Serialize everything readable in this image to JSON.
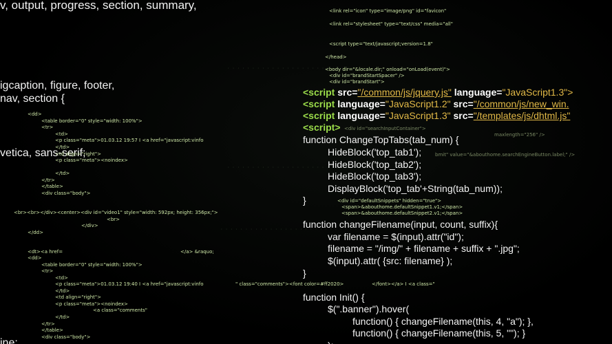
{
  "left_big": [
    "v, output, progress, section, summary,",
    "igcaption, figure, footer,",
    " nav, section {",
    "vetica, sans-serif;",
    "ine;"
  ],
  "left_small": [
    "<dd>",
    "<table border=\"0\" style=\"width: 100%\">",
    "<tr>",
    "<td>",
    "<p class=\"meta\">01.03.12 19:57 I <a href=\"javascript:vinfo",
    "</td>",
    "<td align=\"right\">",
    "<p class=\"meta\"><noindex>",
    "</td>",
    "</tr>",
    "</table>",
    "<div class=\"body\">",
    "<br><br></div><center><div id=\"video1\" style=\"width: 592px; height: 356px;\">",
    "<br>",
    "</div>",
    "</dd>",
    "<dt><a href=",
    "</a> &raquo;",
    "<dd>",
    "<table border=\"0\" style=\"width: 100%\">",
    "<tr>",
    "<td>",
    "<p class=\"meta\">01.03.12 19:40 I <a href=\"javascript:vinfo",
    "</td>",
    "<td align=\"right\">",
    "<p class=\"meta\"><noindex>",
    "<a class=\"comments\"",
    "</td>",
    "</tr>",
    "</table>",
    "<div class=\"body\">",
    "\" class=\"comments\"><font color=#ff2020>",
    "</font></a> I <a class=\""
  ],
  "right_small": [
    "<link rel=\"icon\" type=\"image/png\" id=\"favicon\"",
    "<link rel=\"stylesheet\" type=\"text/css\" media=\"all\"",
    "<script type=\"text/javascript;version=1.8\"",
    "</head>",
    "<body dir=\"&locale.dir;\" onload=\"onLoad(event)\">",
    "<div id=\"brandStartSpacer\" />",
    "<div id=\"brandStart\">",
    "<div id=\"searchInputContainer\">",
    "maxlength=\"256\" />",
    "bmit\" value=\"&abouthome.searchEngineButton.label;\" />",
    "<div id=\"defaultSnippets\" hidden=\"true\">",
    "<span>&abouthome.defaultSnippet1.v1;</span>",
    "<span>&abouthome.defaultSnippet2.v1;</span>"
  ],
  "code": {
    "script1": {
      "tag": "<script",
      "src_attr": "src=",
      "src_val": "\"/common/js/jquery.js\"",
      "lang_attr": "language=",
      "lang_val": "\"JavaScript1.3\">"
    },
    "script2": {
      "tag": "<script",
      "lang_attr": "language=",
      "lang_val": "\"JavaScript1.2\"",
      "src_attr": "src=",
      "src_val": "\"/common/js/new_win."
    },
    "script3": {
      "tag": "<script",
      "lang_attr": "language=",
      "lang_val": "\"JavaScript1.3\"",
      "src_attr": "src=",
      "src_val": "\"/templates/js/dhtml.js\""
    },
    "script4": "<script>",
    "lines": [
      "function ChangeTopTabs(tab_num) {",
      "      HideBlock('top_tab1');",
      "      HideBlock('top_tab2');",
      "      HideBlock('top_tab3');",
      "      DisplayBlock('top_tab'+String(tab_num));",
      "}",
      "",
      "function changeFilename(input, count, suffix){",
      "      var filename = $(input).attr(\"id\");",
      "      filename = \"/img/\" + filename + suffix + \".jpg\";",
      "      $(input).attr( {src: filename} );",
      "}",
      "",
      "function Init() {",
      "      $(\".banner\").hover(",
      "            function() { changeFilename(this, 4, \"a\"); },",
      "            function() { changeFilename(this, 5, \"\"); }",
      "      );"
    ]
  }
}
